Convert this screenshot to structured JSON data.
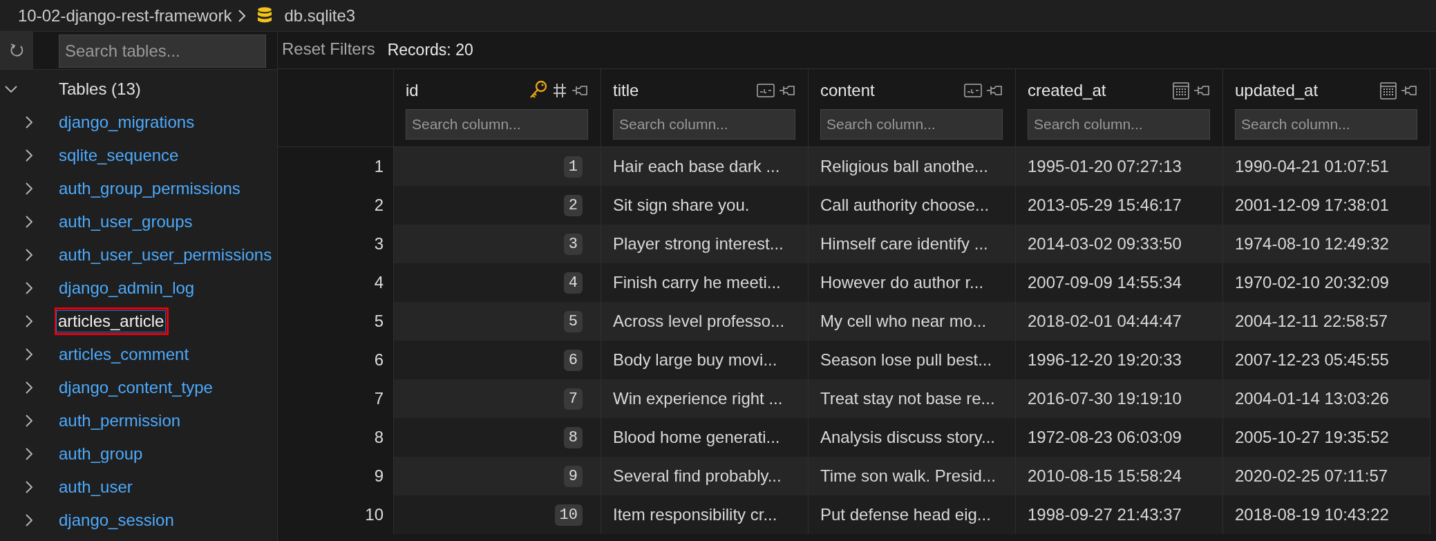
{
  "breadcrumb": {
    "folder": "10-02-django-rest-framework",
    "file": "db.sqlite3"
  },
  "sidebar": {
    "search": {
      "placeholder": "Search tables..."
    },
    "tree": {
      "label": "Tables (13)",
      "expanded": true,
      "children": [
        {
          "label": "django_migrations",
          "expanded": false,
          "selected": false,
          "highlighted": false
        },
        {
          "label": "sqlite_sequence",
          "expanded": false,
          "selected": false,
          "highlighted": false
        },
        {
          "label": "auth_group_permissions",
          "expanded": false,
          "selected": false,
          "highlighted": false
        },
        {
          "label": "auth_user_groups",
          "expanded": false,
          "selected": false,
          "highlighted": false
        },
        {
          "label": "auth_user_user_permissions",
          "expanded": false,
          "selected": false,
          "highlighted": false
        },
        {
          "label": "django_admin_log",
          "expanded": false,
          "selected": false,
          "highlighted": false
        },
        {
          "label": "articles_article",
          "expanded": false,
          "selected": true,
          "highlighted": true
        },
        {
          "label": "articles_comment",
          "expanded": false,
          "selected": false,
          "highlighted": false
        },
        {
          "label": "django_content_type",
          "expanded": false,
          "selected": false,
          "highlighted": false
        },
        {
          "label": "auth_permission",
          "expanded": false,
          "selected": false,
          "highlighted": false
        },
        {
          "label": "auth_group",
          "expanded": false,
          "selected": false,
          "highlighted": false
        },
        {
          "label": "auth_user",
          "expanded": false,
          "selected": false,
          "highlighted": false
        },
        {
          "label": "django_session",
          "expanded": false,
          "selected": false,
          "highlighted": false
        }
      ]
    }
  },
  "toolbar": {
    "reset_button": "Reset Filters",
    "records": "Records: 20"
  },
  "table": {
    "columns": [
      {
        "name": "id",
        "kind": "primary-number",
        "placeholder": "Search column..."
      },
      {
        "name": "title",
        "kind": "text",
        "placeholder": "Search column..."
      },
      {
        "name": "content",
        "kind": "text",
        "placeholder": "Search column..."
      },
      {
        "name": "created_at",
        "kind": "datetime",
        "placeholder": "Search column..."
      },
      {
        "name": "updated_at",
        "kind": "datetime",
        "placeholder": "Search column..."
      }
    ],
    "rows": [
      {
        "row_number": "1",
        "cells": [
          "1",
          "Hair each base dark ...",
          "Religious ball anothe...",
          "1995-01-20 07:27:13",
          "1990-04-21 01:07:51"
        ]
      },
      {
        "row_number": "2",
        "cells": [
          "2",
          "Sit sign share you.",
          "Call authority choose...",
          "2013-05-29 15:46:17",
          "2001-12-09 17:38:01"
        ]
      },
      {
        "row_number": "3",
        "cells": [
          "3",
          "Player strong interest...",
          "Himself care identify ...",
          "2014-03-02 09:33:50",
          "1974-08-10 12:49:32"
        ]
      },
      {
        "row_number": "4",
        "cells": [
          "4",
          "Finish carry he meeti...",
          "However do author r...",
          "2007-09-09 14:55:34",
          "1970-02-10 20:32:09"
        ]
      },
      {
        "row_number": "5",
        "cells": [
          "5",
          "Across level professo...",
          "My cell who near mo...",
          "2018-02-01 04:44:47",
          "2004-12-11 22:58:57"
        ]
      },
      {
        "row_number": "6",
        "cells": [
          "6",
          "Body large buy movi...",
          "Season lose pull best...",
          "1996-12-20 19:20:33",
          "2007-12-23 05:45:55"
        ]
      },
      {
        "row_number": "7",
        "cells": [
          "7",
          "Win experience right ...",
          "Treat stay not base re...",
          "2016-07-30 19:19:10",
          "2004-01-14 13:03:26"
        ]
      },
      {
        "row_number": "8",
        "cells": [
          "8",
          "Blood home generati...",
          "Analysis discuss story...",
          "1972-08-23 06:03:09",
          "2005-10-27 19:35:52"
        ]
      },
      {
        "row_number": "9",
        "cells": [
          "9",
          "Several find probably...",
          "Time son walk. Presid...",
          "2010-08-15 15:58:24",
          "2020-02-25 07:11:57"
        ]
      },
      {
        "row_number": "10",
        "cells": [
          "10",
          "Item responsibility cr...",
          "Put defense head eig...",
          "1998-09-27 21:43:37",
          "2018-08-19 10:43:22"
        ]
      }
    ]
  }
}
